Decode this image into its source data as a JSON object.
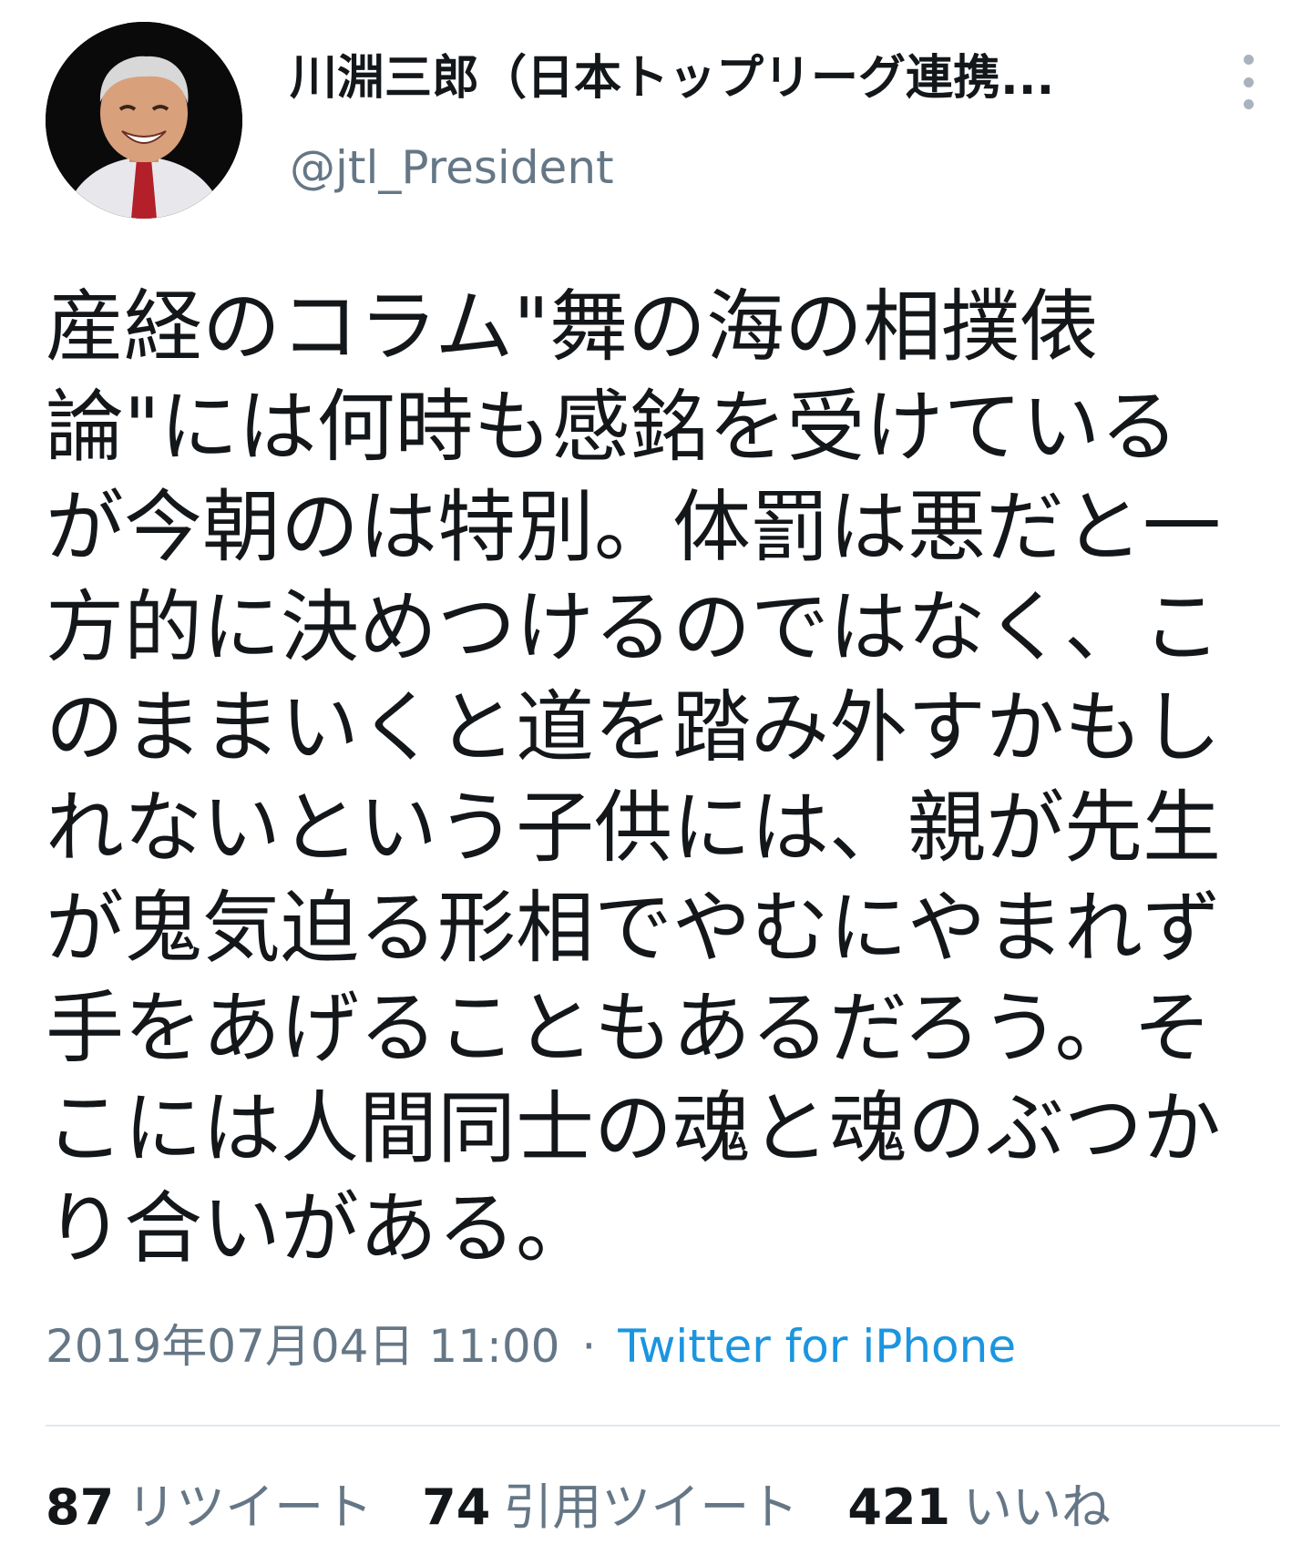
{
  "user": {
    "display_name": "川淵三郎（日本トップリーグ連携...",
    "handle": "@jtl_President",
    "avatar_icon": "profile-photo"
  },
  "menu_icon": "more-vertical-icon",
  "tweet": {
    "text": "産経のコラム\"舞の海の相撲俵\n論\"には何時も感銘を受けている\nが今朝のは特別。体罰は悪だと一\n方的に決めつけるのではなく、こ\nのままいくと道を踏み外すかもし\nれないという子供には、親が先生\nが鬼気迫る形相でやむにやまれず\n手をあげることもあるだろう。そ\nこには人間同士の魂と魂のぶつか\nり合いがある。",
    "timestamp": "2019年07月04日 11:00",
    "separator": "·",
    "source": "Twitter for iPhone"
  },
  "stats": {
    "retweets_count": "87",
    "retweets_label": "リツイート",
    "quotes_count": "74",
    "quotes_label": "引用ツイート",
    "likes_count": "421",
    "likes_label": "いいね"
  },
  "colors": {
    "text": "#14171a",
    "secondary": "#657786",
    "link": "#1b95e0",
    "divider": "#e1e8ed"
  }
}
